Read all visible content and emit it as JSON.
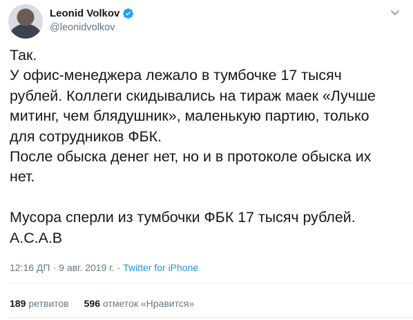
{
  "author": {
    "display_name": "Leonid Volkov",
    "handle": "@leonidvolkov",
    "verified": true
  },
  "icons": {
    "verified": "verified-badge-icon",
    "menu": "chevron-down-icon"
  },
  "tweet": {
    "lines": [
      "Так.",
      "У офис-менеджера лежало в тумбочке 17 тысяч",
      "рублей. Коллеги скидывались на тираж маек «Лучше",
      "митинг, чем блядушник», маленькую партию, только",
      "для сотрудников ФБК.",
      "После обыска денег нет, но и в протоколе обыска их",
      "нет.",
      "Мусора сперли из тумбочки ФБК 17 тысяч рублей.",
      "А.С.А.В"
    ]
  },
  "meta": {
    "time": "12:16 ДП",
    "date": "9 авг. 2019 г.",
    "separator": "·",
    "source": "Twitter for iPhone"
  },
  "stats": {
    "retweets_count": "189",
    "retweets_label": "ретвитов",
    "likes_count": "596",
    "likes_label": "отметок «Нравится»"
  },
  "colors": {
    "text": "#14171a",
    "muted": "#657786",
    "link": "#1b95e0",
    "verified": "#1da1f2"
  }
}
